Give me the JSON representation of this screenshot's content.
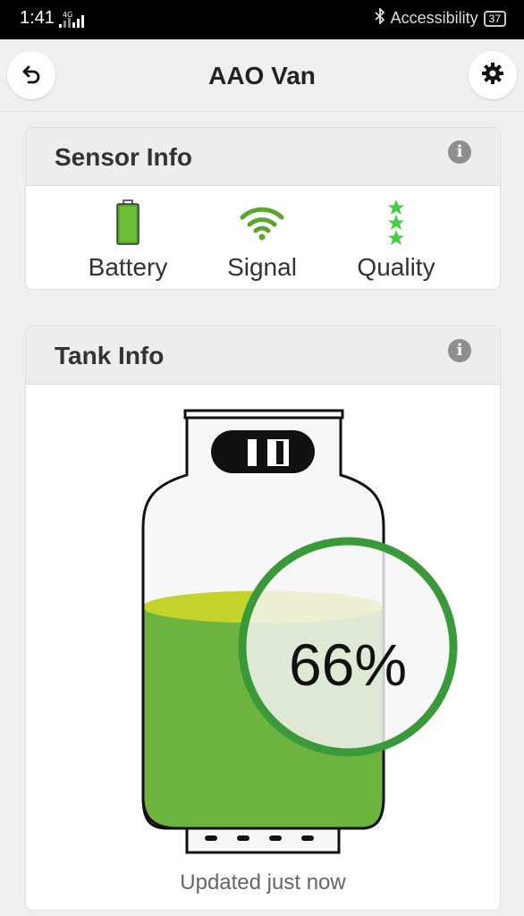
{
  "status_bar": {
    "time": "1:41",
    "network": "4G",
    "accessibility": "Accessibility",
    "battery": "37"
  },
  "header": {
    "title": "AAO Van"
  },
  "sensor_info": {
    "title": "Sensor Info",
    "items": [
      {
        "label": "Battery",
        "icon": "battery-icon",
        "color": "#5aa52c"
      },
      {
        "label": "Signal",
        "icon": "wifi-signal-icon",
        "color": "#5aa52c"
      },
      {
        "label": "Quality",
        "icon": "stars-icon",
        "color": "#44cc44"
      }
    ]
  },
  "tank_info": {
    "title": "Tank Info",
    "level_percent": 66,
    "percent_label": "66%",
    "fill_color": "#6db33f",
    "ring_color": "#3a9a3a",
    "updated": "Updated just now"
  }
}
